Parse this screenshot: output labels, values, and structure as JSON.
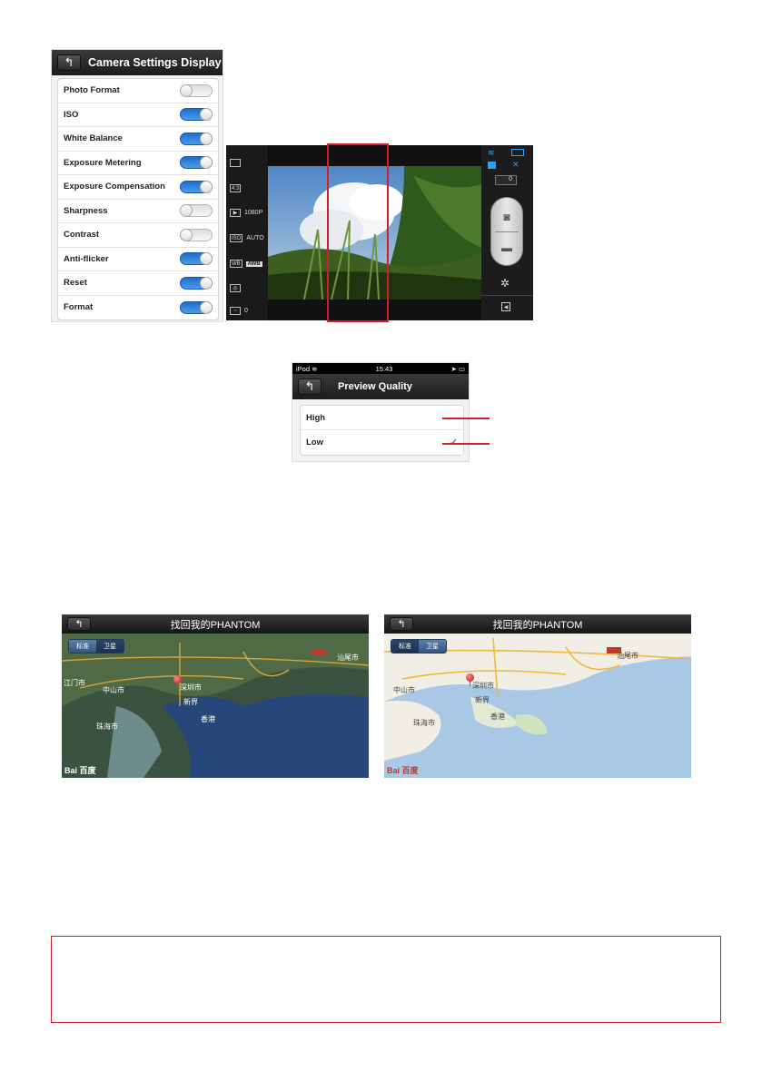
{
  "settings": {
    "back_icon": "back-arrow-icon",
    "title": "Camera Settings Display",
    "items": [
      {
        "label": "Photo Format",
        "on": false
      },
      {
        "label": "ISO",
        "on": true
      },
      {
        "label": "White Balance",
        "on": true
      },
      {
        "label": "Exposure Metering",
        "on": true
      },
      {
        "label": "Exposure Compensation",
        "on": true
      },
      {
        "label": "Sharpness",
        "on": false
      },
      {
        "label": "Contrast",
        "on": false
      },
      {
        "label": "Anti-flicker",
        "on": true
      },
      {
        "label": "Reset",
        "on": true
      },
      {
        "label": "Format",
        "on": true
      }
    ]
  },
  "camera": {
    "left_items": [
      {
        "icon": "",
        "value": ""
      },
      {
        "icon": "4:3",
        "value": ""
      },
      {
        "icon": "▶",
        "value": "1080P"
      },
      {
        "icon": "ISO",
        "value": "AUTO"
      },
      {
        "icon": "WB",
        "value": "AWB"
      },
      {
        "icon": "◎",
        "value": ""
      },
      {
        "icon": "~",
        "value": "0"
      }
    ],
    "photo_count": "0",
    "status_icons": [
      "wifi-icon",
      "battery-icon",
      "sd-card-icon",
      "satellite-icon"
    ]
  },
  "preview": {
    "status": {
      "carrier": "iPod",
      "time": "15:43"
    },
    "title": "Preview Quality",
    "options": [
      {
        "label": "High",
        "selected": false
      },
      {
        "label": "Low",
        "selected": true
      }
    ]
  },
  "maps": [
    {
      "title": "找回我的PHANTOM",
      "tabs": [
        "标准",
        "卫星"
      ],
      "selected_tab": 1,
      "labels": [
        "江门市",
        "中山市",
        "深圳市",
        "新界",
        "珠海市",
        "香港",
        "汕尾市"
      ],
      "logo": "Bai 百度"
    },
    {
      "title": "找回我的PHANTOM",
      "tabs": [
        "标准",
        "卫星"
      ],
      "selected_tab": 0,
      "labels": [
        "中山市",
        "深圳市",
        "新界",
        "珠海市",
        "香港",
        "汕尾市"
      ],
      "logo": "Bai 百度"
    }
  ],
  "colors": {
    "accent_red": "#d51c2a",
    "toggle_blue": "#1a6fc9"
  }
}
